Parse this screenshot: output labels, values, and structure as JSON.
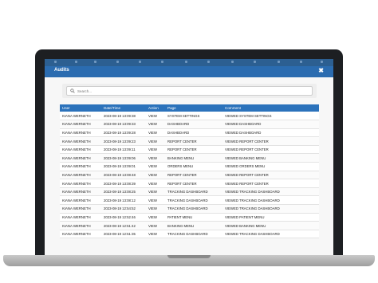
{
  "modal": {
    "title": "Audits",
    "close_label": "✖"
  },
  "search": {
    "placeholder": "Search..."
  },
  "table": {
    "headers": [
      "User",
      "Date/Time",
      "Action",
      "Page",
      "Comment"
    ],
    "rows": [
      [
        "KIANA WERNETH",
        "2023-08-19 13:09:38",
        "VIEW",
        "SYSTEM SETTINGS",
        "VIEWED SYSTEM SETTINGS"
      ],
      [
        "KIANA WERNETH",
        "2023-08-19 13:09:33",
        "VIEW",
        "DASHBOARD",
        "VIEWED DASHBOARD"
      ],
      [
        "KIANA WERNETH",
        "2023-08-19 13:09:28",
        "VIEW",
        "DASHBOARD",
        "VIEWED DASHBOARD"
      ],
      [
        "KIANA WERNETH",
        "2023-08-19 13:09:23",
        "VIEW",
        "REPORT CENTER",
        "VIEWED REPORT CENTER"
      ],
      [
        "KIANA WERNETH",
        "2023-08-19 13:09:11",
        "VIEW",
        "REPORT CENTER",
        "VIEWED REPORT CENTER"
      ],
      [
        "KIANA WERNETH",
        "2023-08-19 13:09:06",
        "VIEW",
        "BANKING MENU",
        "VIEWED BANKING MENU"
      ],
      [
        "KIANA WERNETH",
        "2023-08-19 13:09:01",
        "VIEW",
        "ORDERS MENU",
        "VIEWED ORDERS MENU"
      ],
      [
        "KIANA WERNETH",
        "2023-08-19 13:08:48",
        "VIEW",
        "REPORT CENTER",
        "VIEWED REPORT CENTER"
      ],
      [
        "KIANA WERNETH",
        "2023-08-19 13:08:39",
        "VIEW",
        "REPORT CENTER",
        "VIEWED REPORT CENTER"
      ],
      [
        "KIANA WERNETH",
        "2023-08-19 13:08:25",
        "VIEW",
        "TRACKING DASHBOARD",
        "VIEWED TRACKING DASHBOARD"
      ],
      [
        "KIANA WERNETH",
        "2023-08-19 13:08:12",
        "VIEW",
        "TRACKING DASHBOARD",
        "VIEWED TRACKING DASHBOARD"
      ],
      [
        "KIANA WERNETH",
        "2023-08-19 12:54:52",
        "VIEW",
        "TRACKING DASHBOARD",
        "VIEWED TRACKING DASHBOARD"
      ],
      [
        "KIANA WERNETH",
        "2023-08-19 12:52:46",
        "VIEW",
        "PATIENT MENU",
        "VIEWED PATIENT MENU"
      ],
      [
        "KIANA WERNETH",
        "2023-08-19 12:51:42",
        "VIEW",
        "BANKING MENU",
        "VIEWED BANKING MENU"
      ],
      [
        "KIANA WERNETH",
        "2023-08-19 12:51:35",
        "VIEW",
        "TRACKING DASHBOARD",
        "VIEWED TRACKING DASHBOARD"
      ]
    ]
  },
  "colors": {
    "header_bar": "#2b6cb0",
    "table_header": "#2b72bb",
    "laptop_bezel": "#1d1f22"
  }
}
